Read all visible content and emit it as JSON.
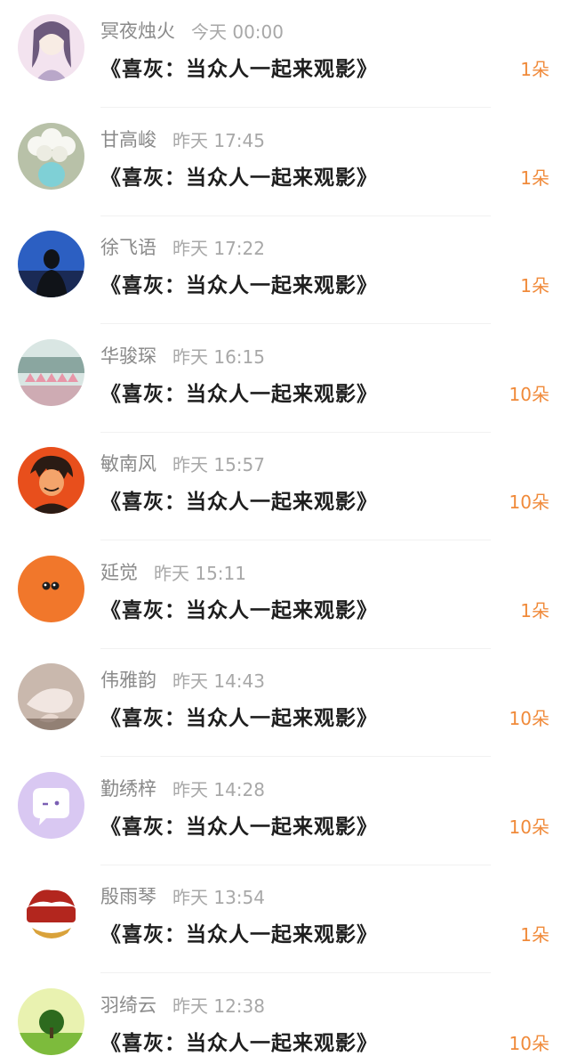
{
  "gift_list": [
    {
      "name": "冥夜烛火",
      "time": "今天 00:00",
      "title": "《喜灰：当众人一起来观影》",
      "amount": "1朵",
      "avatar_icon": "anime-girl-avatar",
      "avatar_colors": [
        "#f3e3ef",
        "#b9a7c9",
        "#6d5a7d"
      ]
    },
    {
      "name": "甘高峻",
      "time": "昨天 17:45",
      "title": "《喜灰：当众人一起来观影》",
      "amount": "1朵",
      "avatar_icon": "white-flowers-vase-avatar",
      "avatar_colors": [
        "#b8c1a8",
        "#f7f7f2",
        "#7fd0d6"
      ]
    },
    {
      "name": "徐飞语",
      "time": "昨天 17:22",
      "title": "《喜灰：当众人一起来观影》",
      "amount": "1朵",
      "avatar_icon": "person-silhouette-avatar",
      "avatar_colors": [
        "#2c5fc2",
        "#1a2a55",
        "#101318"
      ]
    },
    {
      "name": "华骏琛",
      "time": "昨天 16:15",
      "title": "《喜灰：当众人一起来观影》",
      "amount": "10朵",
      "avatar_icon": "pink-cups-avatar",
      "avatar_colors": [
        "#d9e6e3",
        "#e896a8",
        "#8aa6a0"
      ]
    },
    {
      "name": "敏南风",
      "time": "昨天 15:57",
      "title": "《喜灰：当众人一起来观影》",
      "amount": "10朵",
      "avatar_icon": "anime-boy-avatar",
      "avatar_colors": [
        "#e84f1c",
        "#2a1b14",
        "#f4a46b"
      ]
    },
    {
      "name": "延觉",
      "time": "昨天 15:11",
      "title": "《喜灰：当众人一起来观影》",
      "amount": "1朵",
      "avatar_icon": "orange-skull-avatar",
      "avatar_colors": [
        "#f1772b",
        "#1d1d1d",
        "#ffffff"
      ]
    },
    {
      "name": "伟雅韵",
      "time": "昨天 14:43",
      "title": "《喜灰：当众人一起来观影》",
      "amount": "10朵",
      "avatar_icon": "seashells-avatar",
      "avatar_colors": [
        "#c9b8ad",
        "#f1e6e1",
        "#6e5a4e"
      ]
    },
    {
      "name": "勤绣梓",
      "time": "昨天 14:28",
      "title": "《喜灰：当众人一起来观影》",
      "amount": "10朵",
      "avatar_icon": "chat-bubble-avatar",
      "avatar_colors": [
        "#d9c8f2",
        "#ffffff",
        "#7b5fb3"
      ]
    },
    {
      "name": "殷雨琴",
      "time": "昨天 13:54",
      "title": "《喜灰：当众人一起来观影》",
      "amount": "1朵",
      "avatar_icon": "dragon-logo-avatar",
      "avatar_colors": [
        "#ffffff",
        "#b3261e",
        "#d9a23b"
      ]
    },
    {
      "name": "羽绮云",
      "time": "昨天 12:38",
      "title": "《喜灰：当众人一起来观影》",
      "amount": "10朵",
      "avatar_icon": "green-tree-avatar",
      "avatar_colors": [
        "#e9f2b0",
        "#7dbb3c",
        "#2d6a1e"
      ]
    }
  ]
}
